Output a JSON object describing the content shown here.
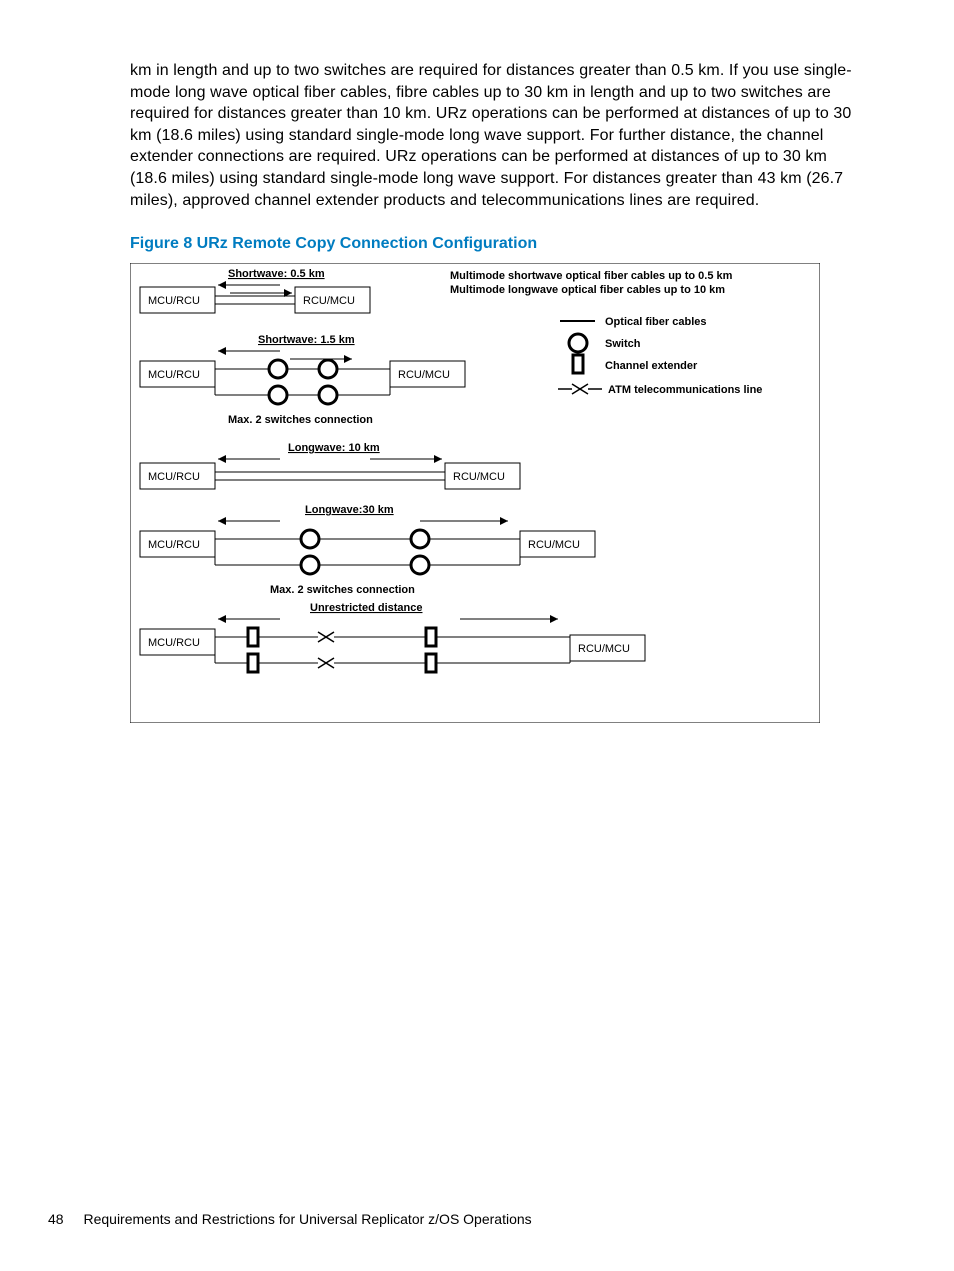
{
  "paragraph": "km in length and up to two switches are required for distances greater than 0.5 km. If you use single-mode long wave optical fiber cables, fibre cables up to 30 km in length and up to two switches are required for distances greater than 10 km. URz operations can be performed at distances of up to 30 km (18.6 miles) using standard single-mode long wave support. For further distance, the channel extender connections are required. URz operations can be performed at distances of up to 30 km (18.6 miles) using standard single-mode long wave support. For distances greater than 43 km (26.7 miles), approved channel extender products and telecommunications lines are required.",
  "figure_caption": "Figure 8 URz Remote Copy Connection Configuration",
  "diagram": {
    "box_left": "MCU/RCU",
    "box_right": "RCU/MCU",
    "labels": {
      "row1": "Shortwave: 0.5 km",
      "row2": "Shortwave: 1.5 km",
      "row2_note": "Max. 2 switches connection",
      "row3": "Longwave: 10 km",
      "row4": "Longwave:30 km",
      "row4_note": "Max. 2 switches connection",
      "row5": "Unrestricted distance"
    },
    "legend": {
      "hdr1": "Multimode shortwave optical fiber cables up to 0.5 km",
      "hdr2": "Multimode longwave optical fiber cables up to 10 km",
      "item_line": "Optical fiber cables",
      "item_switch": "Switch",
      "item_extender": "Channel extender",
      "item_atm": "ATM telecommunications line"
    }
  },
  "footer": {
    "page": "48",
    "title": "Requirements and Restrictions for Universal Replicator z/OS Operations"
  }
}
